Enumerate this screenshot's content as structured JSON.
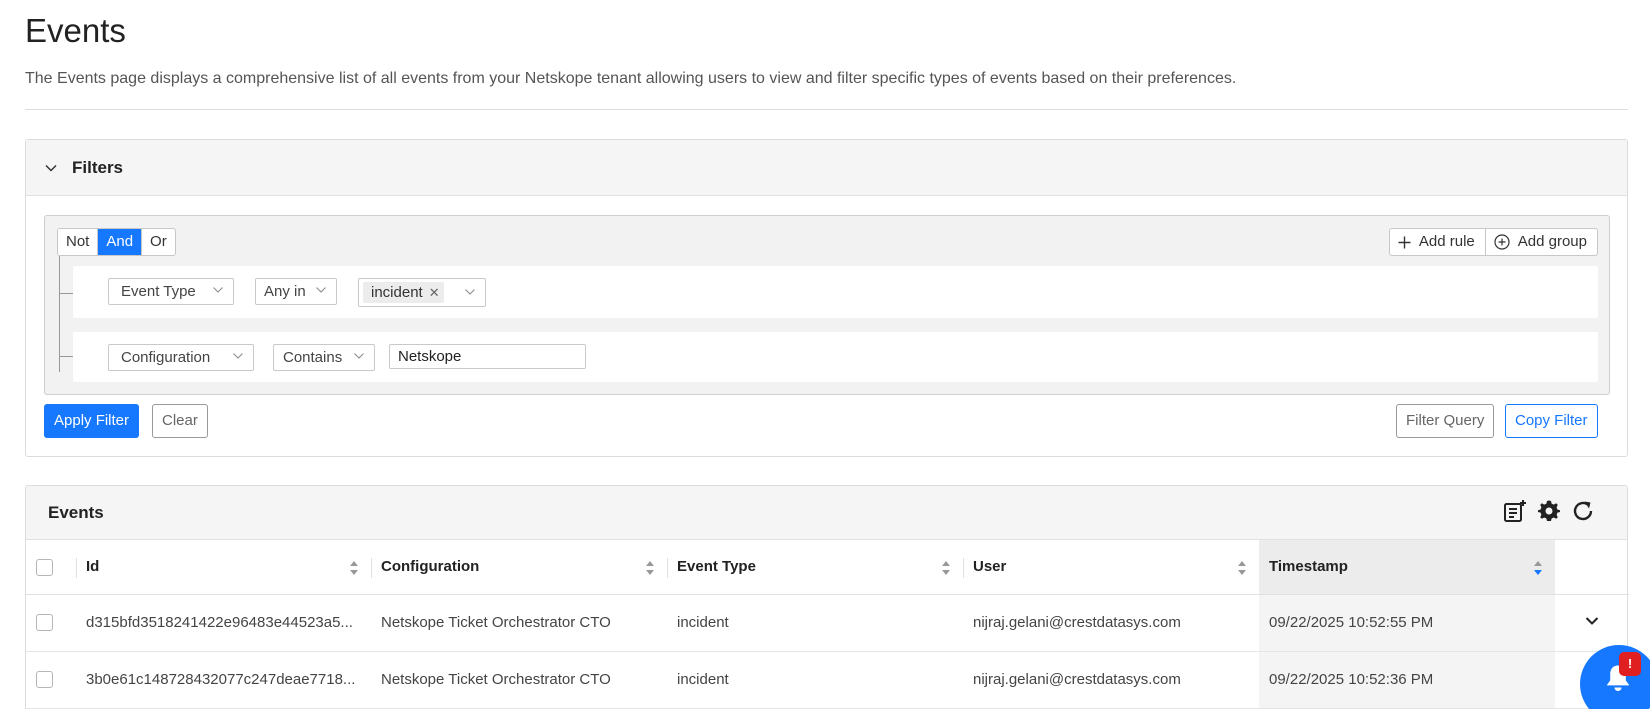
{
  "page": {
    "title": "Events",
    "description": "The Events page displays a comprehensive list of all events from your Netskope tenant allowing users to view and filter specific types of events based on their preferences."
  },
  "filters": {
    "title": "Filters",
    "combinators": [
      "Not",
      "And",
      "Or"
    ],
    "active_combinator": "And",
    "add_rule_label": "Add rule",
    "add_group_label": "Add group",
    "rules": [
      {
        "field": "Event Type",
        "operator": "Any in",
        "value_tag": "incident"
      },
      {
        "field": "Configuration",
        "operator": "Contains",
        "value": "Netskope"
      }
    ],
    "apply_label": "Apply Filter",
    "clear_label": "Clear",
    "filter_query_label": "Filter Query",
    "copy_filter_label": "Copy Filter"
  },
  "events": {
    "title": "Events",
    "columns": [
      "Id",
      "Configuration",
      "Event Type",
      "User",
      "Timestamp"
    ],
    "rows": [
      {
        "id": "d315bfd3518241422e96483e44523a5...",
        "configuration": "Netskope Ticket Orchestrator CTO",
        "event_type": "incident",
        "user": "nijraj.gelani@crestdatasys.com",
        "timestamp": "09/22/2025 10:52:55 PM"
      },
      {
        "id": "3b0e61c148728432077c247deae7718...",
        "configuration": "Netskope Ticket Orchestrator CTO",
        "event_type": "incident",
        "user": "nijraj.gelani@crestdatasys.com",
        "timestamp": "09/22/2025 10:52:36 PM"
      }
    ]
  },
  "notification": {
    "badge": "!"
  },
  "colors": {
    "primary": "#1677ff",
    "badge": "#e02020"
  }
}
